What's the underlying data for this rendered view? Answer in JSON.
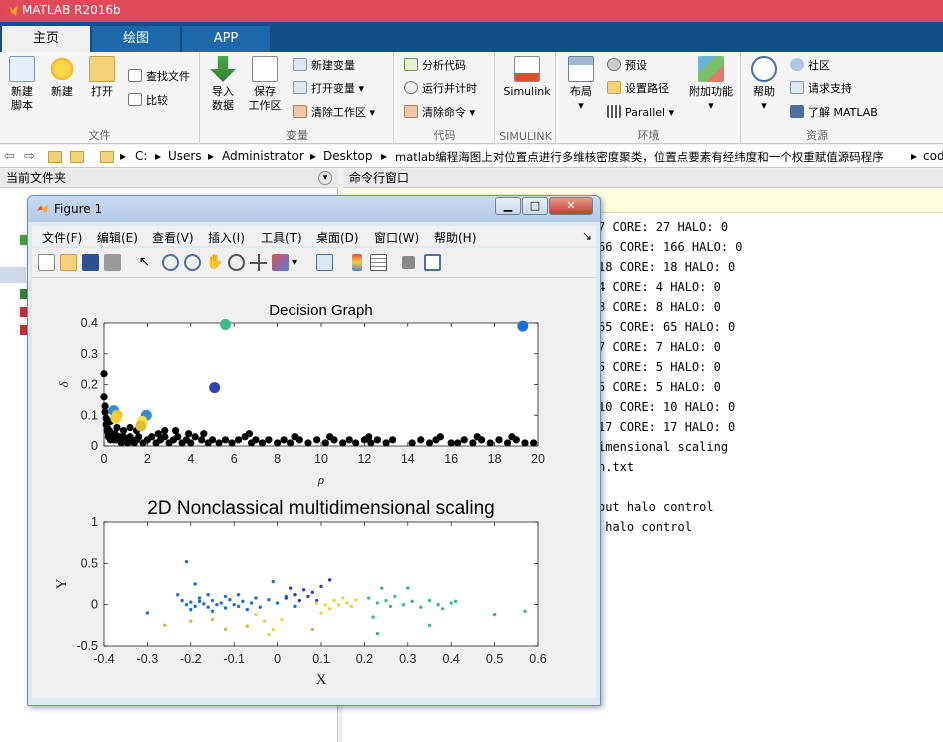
{
  "window": {
    "title": "MATLAB R2016b"
  },
  "tabs": [
    {
      "label": "主页",
      "active": true
    },
    {
      "label": "绘图",
      "active": false
    },
    {
      "label": "APP",
      "active": false
    }
  ],
  "ribbon": {
    "file": {
      "label": "文件",
      "new_script": "新建\n脚本",
      "new": "新建",
      "open": "打开",
      "find_files": "查找文件",
      "compare": "比较"
    },
    "variable": {
      "label": "变量",
      "import_data": "导入\n数据",
      "save_workspace": "保存\n工作区",
      "new_variable": "新建变量",
      "open_variable": "打开变量",
      "clear_workspace": "清除工作区"
    },
    "code": {
      "label": "代码",
      "analyze": "分析代码",
      "run_time": "运行并计时",
      "clear_commands": "清除命令"
    },
    "simulink": {
      "label": "SIMULINK",
      "simulink": "Simulink"
    },
    "environment": {
      "label": "环境",
      "layout": "布局",
      "preferences": "预设",
      "set_path": "设置路径",
      "parallel": "Parallel",
      "addons": "附加功能"
    },
    "resources": {
      "label": "资源",
      "help": "帮助",
      "community": "社区",
      "request_support": "请求支持",
      "learn_matlab": "了解 MATLAB"
    }
  },
  "address_bar": {
    "path": [
      "C:",
      "Users",
      "Administrator",
      "Desktop",
      "matlab编程海图上对位置点进行多维核密度聚类，位置点要素有经纬度和一个权重赋值源码程序",
      "cod"
    ]
  },
  "panels": {
    "current_folder": "当前文件夹",
    "command_window": "命令行窗口"
  },
  "command_output": [
    "7 CORE: 27 HALO: 0",
    "66 CORE: 166 HALO: 0",
    "18 CORE: 18 HALO: 0",
    "4 CORE: 4 HALO: 0",
    "8 CORE: 8 HALO: 0",
    "65 CORE: 65 HALO: 0",
    "7 CORE: 7 HALO: 0",
    "5 CORE: 5 HALO: 0",
    "5 CORE: 5 HALO: 0",
    "10 CORE: 10 HALO: 0",
    "17 CORE: 17 HALO: 0",
    "imensional scaling",
    "n.txt",
    "",
    "out halo control",
    " halo control"
  ],
  "figure": {
    "title": "Figure 1",
    "menu": [
      "文件(F)",
      "编辑(E)",
      "查看(V)",
      "插入(I)",
      "工具(T)",
      "桌面(D)",
      "窗口(W)",
      "帮助(H)"
    ]
  },
  "chart_data": [
    {
      "type": "scatter",
      "title": "Decision Graph",
      "xlabel": "ρ",
      "ylabel": "δ",
      "xlim": [
        0,
        20
      ],
      "ylim": [
        0,
        0.4
      ],
      "xticks": [
        0,
        2,
        4,
        6,
        8,
        10,
        12,
        14,
        16,
        18,
        20
      ],
      "yticks": [
        0,
        0.1,
        0.2,
        0.3,
        0.4
      ],
      "centers": [
        {
          "x": 19.3,
          "y": 0.39,
          "color": "#1d6fd6"
        },
        {
          "x": 5.6,
          "y": 0.395,
          "color": "#3dba8a"
        },
        {
          "x": 5.1,
          "y": 0.19,
          "color": "#2e3fbf"
        },
        {
          "x": 0.45,
          "y": 0.115,
          "color": "#2f8fd8"
        },
        {
          "x": 0.6,
          "y": 0.1,
          "color": "#f0c020"
        },
        {
          "x": 1.95,
          "y": 0.1,
          "color": "#2f8fd8"
        },
        {
          "x": 1.75,
          "y": 0.08,
          "color": "#f7e34a"
        },
        {
          "x": 0.55,
          "y": 0.09,
          "color": "#f2d23a"
        },
        {
          "x": 1.7,
          "y": 0.065,
          "color": "#e0c030"
        }
      ],
      "points_color": "#000000",
      "points": [
        [
          0,
          0.235
        ],
        [
          0,
          0.16
        ],
        [
          0.05,
          0.13
        ],
        [
          0.05,
          0.11
        ],
        [
          0.1,
          0.09
        ],
        [
          0.1,
          0.07
        ],
        [
          0.15,
          0.06
        ],
        [
          0.15,
          0.05
        ],
        [
          0.2,
          0.04
        ],
        [
          0.2,
          0.03
        ],
        [
          0.25,
          0.05
        ],
        [
          0.3,
          0.02
        ],
        [
          0.35,
          0.04
        ],
        [
          0.4,
          0.03
        ],
        [
          0.45,
          0.02
        ],
        [
          0.5,
          0.04
        ],
        [
          0.6,
          0.02
        ],
        [
          0.7,
          0.03
        ],
        [
          0.8,
          0.01
        ],
        [
          0.9,
          0.03
        ],
        [
          1.0,
          0.02
        ],
        [
          1.1,
          0.01
        ],
        [
          1.2,
          0.03
        ],
        [
          1.3,
          0.02
        ],
        [
          1.4,
          0.01
        ],
        [
          1.5,
          0.02
        ],
        [
          1.6,
          0.03
        ],
        [
          1.8,
          0.01
        ],
        [
          2.0,
          0.02
        ],
        [
          2.2,
          0.03
        ],
        [
          2.4,
          0.01
        ],
        [
          2.6,
          0.02
        ],
        [
          2.8,
          0.03
        ],
        [
          3.0,
          0.01
        ],
        [
          3.2,
          0.02
        ],
        [
          3.4,
          0.03
        ],
        [
          3.6,
          0.01
        ],
        [
          3.8,
          0.02
        ],
        [
          4.0,
          0.01
        ],
        [
          4.2,
          0.03
        ],
        [
          4.5,
          0.02
        ],
        [
          4.8,
          0.01
        ],
        [
          5.0,
          0.02
        ],
        [
          5.3,
          0.01
        ],
        [
          5.6,
          0.02
        ],
        [
          5.9,
          0.01
        ],
        [
          6.2,
          0.02
        ],
        [
          6.5,
          0.03
        ],
        [
          6.8,
          0.01
        ],
        [
          7.0,
          0.02
        ],
        [
          7.3,
          0.01
        ],
        [
          7.6,
          0.02
        ],
        [
          8.0,
          0.01
        ],
        [
          8.3,
          0.02
        ],
        [
          8.6,
          0.01
        ],
        [
          9.0,
          0.02
        ],
        [
          9.4,
          0.01
        ],
        [
          9.8,
          0.02
        ],
        [
          10.2,
          0.01
        ],
        [
          10.6,
          0.02
        ],
        [
          11.0,
          0.01
        ],
        [
          11.3,
          0.02
        ],
        [
          11.6,
          0.01
        ],
        [
          12.0,
          0.02
        ],
        [
          12.3,
          0.01
        ],
        [
          12.6,
          0.02
        ],
        [
          13.0,
          0.01
        ],
        [
          13.3,
          0.02
        ],
        [
          14.2,
          0.01
        ],
        [
          14.6,
          0.02
        ],
        [
          15.0,
          0.01
        ],
        [
          15.3,
          0.02
        ],
        [
          16.0,
          0.01
        ],
        [
          16.3,
          0.01
        ],
        [
          16.6,
          0.02
        ],
        [
          17.0,
          0.01
        ],
        [
          17.4,
          0.02
        ],
        [
          17.8,
          0.01
        ],
        [
          18.2,
          0.02
        ],
        [
          18.6,
          0.01
        ],
        [
          19.0,
          0.02
        ],
        [
          19.4,
          0.01
        ],
        [
          19.8,
          0.01
        ],
        [
          0.3,
          0.08
        ],
        [
          0.6,
          0.06
        ],
        [
          0.9,
          0.05
        ],
        [
          1.2,
          0.06
        ],
        [
          2.5,
          0.04
        ],
        [
          3.3,
          0.05
        ],
        [
          4.6,
          0.04
        ],
        [
          6.7,
          0.04
        ],
        [
          8.8,
          0.03
        ],
        [
          10.4,
          0.03
        ],
        [
          12.2,
          0.03
        ],
        [
          15.5,
          0.03
        ],
        [
          17.2,
          0.03
        ],
        [
          18.8,
          0.03
        ],
        [
          2.8,
          0.05
        ],
        [
          3.9,
          0.04
        ],
        [
          1.5,
          0.05
        ]
      ]
    },
    {
      "type": "scatter",
      "title": "2D Nonclassical multidimensional scaling",
      "xlabel": "X",
      "ylabel": "Y",
      "xlim": [
        -0.4,
        0.6
      ],
      "ylim": [
        -0.5,
        1
      ],
      "xticks": [
        -0.4,
        -0.3,
        -0.2,
        -0.1,
        0,
        0.1,
        0.2,
        0.3,
        0.4,
        0.5,
        0.6
      ],
      "yticks": [
        -0.5,
        0,
        0.5,
        1
      ],
      "series": [
        {
          "color": "#1d6fd6",
          "points": [
            [
              -0.22,
              0.05
            ],
            [
              -0.21,
              0.0
            ],
            [
              -0.2,
              0.03
            ],
            [
              -0.19,
              -0.02
            ],
            [
              -0.18,
              0.04
            ],
            [
              -0.17,
              0.01
            ],
            [
              -0.16,
              -0.03
            ],
            [
              -0.15,
              0.05
            ],
            [
              -0.14,
              0.0
            ],
            [
              -0.13,
              0.02
            ],
            [
              -0.12,
              -0.04
            ],
            [
              -0.11,
              0.06
            ],
            [
              -0.1,
              0.0
            ],
            [
              -0.09,
              -0.02
            ],
            [
              -0.08,
              0.04
            ],
            [
              -0.07,
              -0.06
            ],
            [
              -0.06,
              0.02
            ],
            [
              -0.05,
              0.08
            ],
            [
              -0.2,
              -0.06
            ],
            [
              -0.18,
              0.08
            ],
            [
              -0.15,
              -0.08
            ],
            [
              -0.12,
              0.1
            ],
            [
              -0.09,
              0.12
            ],
            [
              -0.04,
              -0.03
            ],
            [
              -0.02,
              0.06
            ],
            [
              0.0,
              0.02
            ],
            [
              0.02,
              0.1
            ],
            [
              0.04,
              -0.02
            ],
            [
              -0.21,
              0.52
            ],
            [
              -0.19,
              0.25
            ],
            [
              -0.3,
              -0.1
            ],
            [
              -0.16,
              0.12
            ],
            [
              -0.23,
              0.12
            ],
            [
              -0.01,
              0.28
            ]
          ]
        },
        {
          "color": "#2e3fbf",
          "points": [
            [
              0.02,
              0.08
            ],
            [
              0.04,
              0.12
            ],
            [
              0.05,
              0.05
            ],
            [
              0.06,
              0.18
            ],
            [
              0.07,
              0.1
            ],
            [
              0.08,
              0.15
            ],
            [
              0.1,
              0.22
            ],
            [
              0.12,
              0.3
            ],
            [
              0.03,
              0.2
            ],
            [
              0.09,
              0.05
            ]
          ]
        },
        {
          "color": "#f2d23a",
          "points": [
            [
              0.09,
              0.02
            ],
            [
              0.11,
              0.0
            ],
            [
              0.13,
              0.05
            ],
            [
              0.14,
              0.0
            ],
            [
              0.15,
              0.08
            ],
            [
              0.16,
              0.02
            ],
            [
              0.17,
              -0.02
            ],
            [
              0.18,
              0.06
            ],
            [
              -0.03,
              -0.2
            ],
            [
              -0.01,
              -0.3
            ],
            [
              0.01,
              -0.18
            ],
            [
              -0.05,
              -0.12
            ],
            [
              0.12,
              -0.05
            ],
            [
              0.1,
              -0.1
            ],
            [
              -0.02,
              -0.36
            ]
          ]
        },
        {
          "color": "#3dba8a",
          "points": [
            [
              0.21,
              0.08
            ],
            [
              0.23,
              0.02
            ],
            [
              0.25,
              0.05
            ],
            [
              0.26,
              -0.02
            ],
            [
              0.27,
              0.1
            ],
            [
              0.29,
              0.0
            ],
            [
              0.31,
              0.04
            ],
            [
              0.33,
              -0.03
            ],
            [
              0.35,
              0.05
            ],
            [
              0.37,
              0.0
            ],
            [
              0.38,
              -0.05
            ],
            [
              0.4,
              0.02
            ],
            [
              0.41,
              0.04
            ],
            [
              0.24,
              0.2
            ],
            [
              0.23,
              -0.35
            ],
            [
              0.35,
              -0.25
            ],
            [
              0.5,
              -0.12
            ],
            [
              0.57,
              -0.08
            ],
            [
              0.3,
              0.2
            ],
            [
              0.22,
              -0.15
            ]
          ]
        },
        {
          "color": "#d4b840",
          "points": [
            [
              -0.26,
              -0.25
            ],
            [
              -0.15,
              -0.18
            ],
            [
              -0.12,
              -0.3
            ],
            [
              -0.07,
              -0.26
            ],
            [
              0.08,
              -0.3
            ],
            [
              -0.2,
              -0.2
            ]
          ]
        }
      ]
    }
  ]
}
